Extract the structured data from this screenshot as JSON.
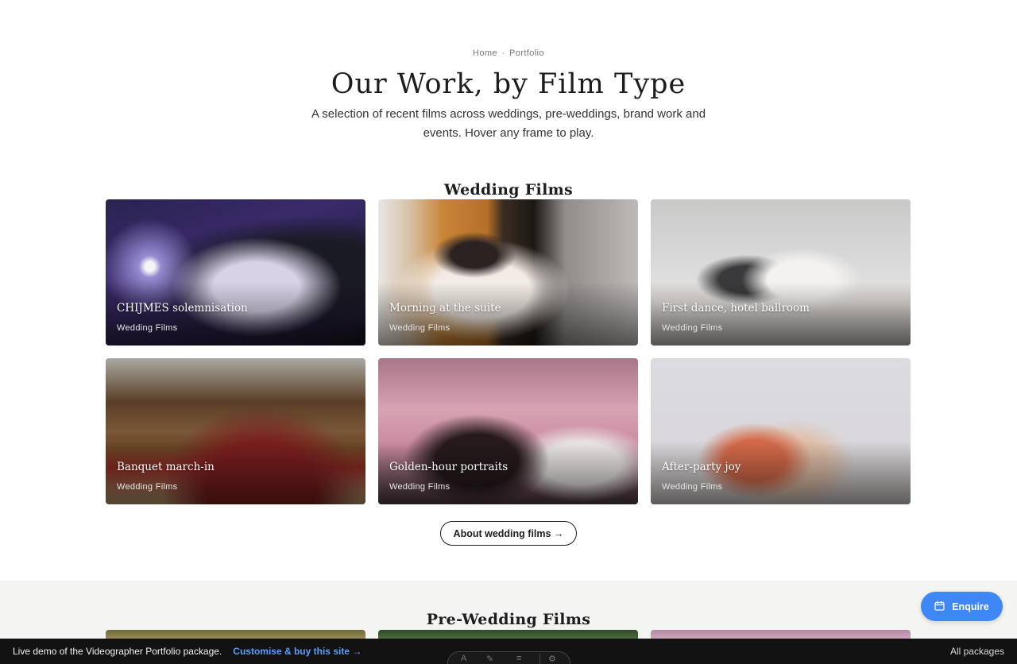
{
  "breadcrumb": {
    "home": "Home",
    "separator": "·",
    "current": "Portfolio"
  },
  "hero": {
    "title": "Our Work, by Film Type",
    "subtitle": "A selection of recent films across weddings, pre-weddings, brand work and events. Hover any frame to play."
  },
  "wedding": {
    "title": "Wedding Films",
    "cards": [
      {
        "title": "CHIJMES solemnisation",
        "category": "Wedding Films"
      },
      {
        "title": "Morning at the suite",
        "category": "Wedding Films"
      },
      {
        "title": "First dance, hotel ballroom",
        "category": "Wedding Films"
      },
      {
        "title": "Banquet march-in",
        "category": "Wedding Films"
      },
      {
        "title": "Golden-hour portraits",
        "category": "Wedding Films"
      },
      {
        "title": "After-party joy",
        "category": "Wedding Films"
      }
    ],
    "about_button": "About wedding films →"
  },
  "prewedding": {
    "title": "Pre-Wedding Films"
  },
  "enquire": {
    "label": "Enquire",
    "icon": "calendar-icon"
  },
  "demo_bar": {
    "text": "Live demo of the Videographer Portfolio package.",
    "link": "Customise & buy this site →",
    "right": "All packages"
  },
  "colors": {
    "accent": "#3f87f5",
    "demo_bar_bg": "#121212",
    "link": "#5aa0ff"
  }
}
